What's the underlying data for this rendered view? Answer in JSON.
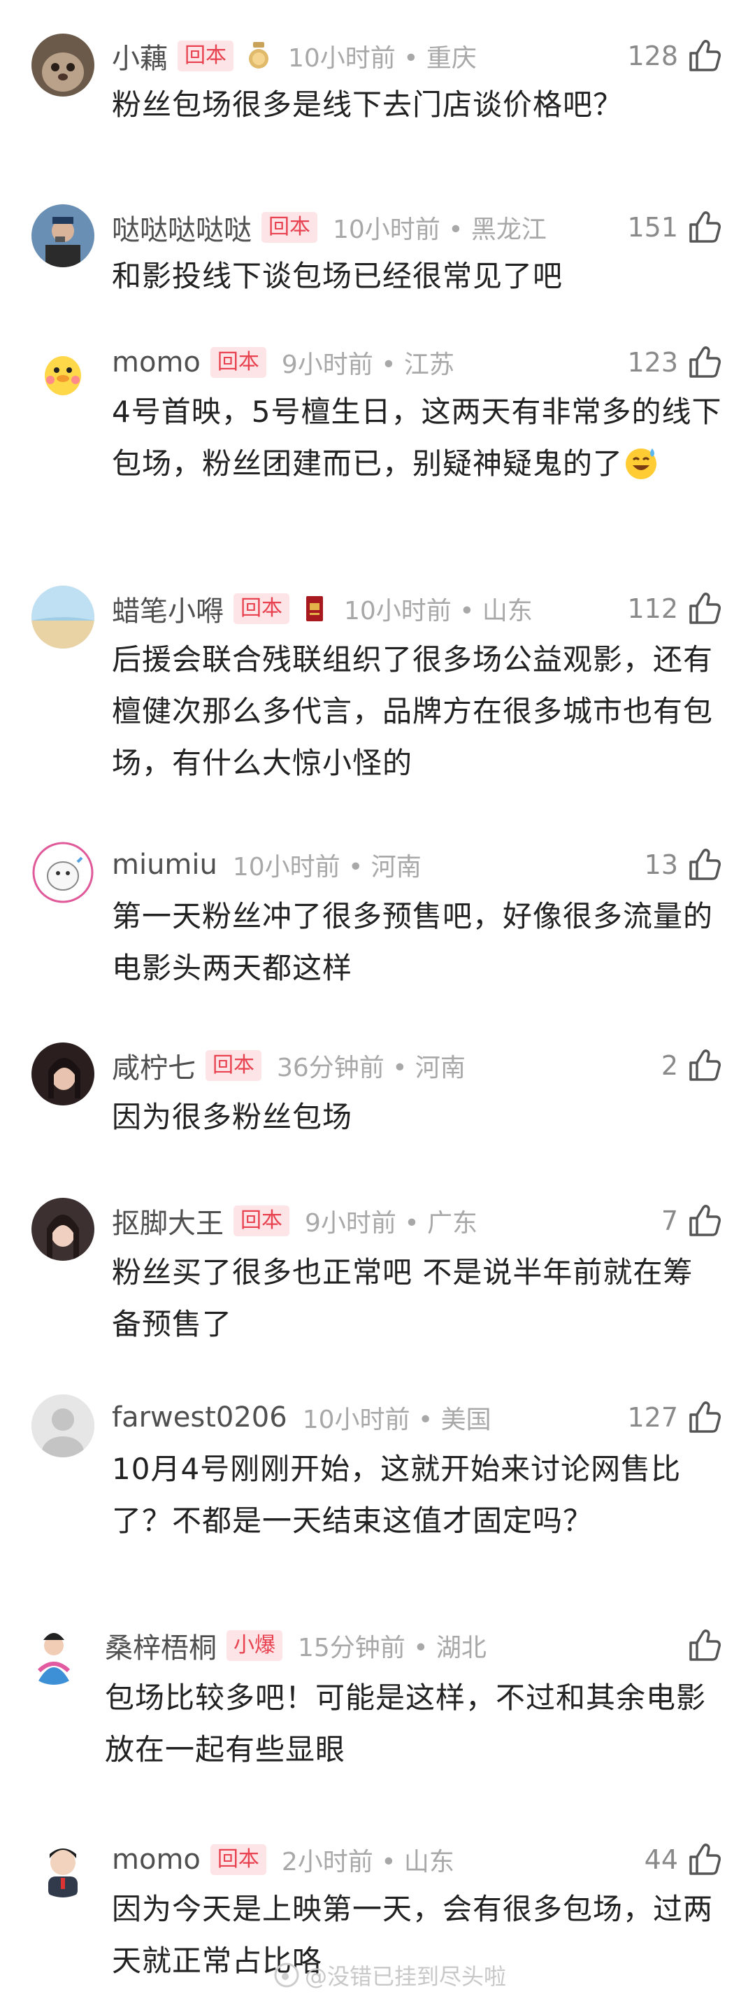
{
  "colors": {
    "badge_text": "#e8414f",
    "badge_bg": "#fde4e6",
    "meta": "#a8a8a8",
    "name": "#4f4f4f",
    "body": "#222222"
  },
  "comments": [
    {
      "name": "小藕",
      "badge": "回本",
      "meta": "10小时前 • 重庆",
      "likes": "128",
      "text": "粉丝包场很多是线下去门店谈价格吧？",
      "medal": "gold-medal-icon"
    },
    {
      "name": "哒哒哒哒哒",
      "badge": "回本",
      "meta": "10小时前 • 黑龙江",
      "likes": "151",
      "text": "和影投线下谈包场已经很常见了吧"
    },
    {
      "name": "momo",
      "badge": "回本",
      "meta": "9小时前 • 江苏",
      "likes": "123",
      "text": "4号首映，5号檀生日，这两天有非常多的线下包场，粉丝团建而已，别疑神疑鬼的了",
      "emoji": "sweat-smile-emoji"
    },
    {
      "name": "蜡笔小嘚",
      "badge": "回本",
      "meta": "10小时前 • 山东",
      "likes": "112",
      "text": "后援会联合残联组织了很多场公益观影，还有檀健次那么多代言，品牌方在很多城市也有包场，有什么大惊小怪的",
      "medal": "red-book-medal-icon"
    },
    {
      "name": "miumiu",
      "badge": "",
      "meta": "10小时前 • 河南",
      "likes": "13",
      "text": "第一天粉丝冲了很多预售吧，好像很多流量的电影头两天都这样"
    },
    {
      "name": "咸柠七",
      "badge": "回本",
      "meta": "36分钟前 • 河南",
      "likes": "2",
      "text": "因为很多粉丝包场"
    },
    {
      "name": "抠脚大王",
      "badge": "回本",
      "meta": "9小时前 • 广东",
      "likes": "7",
      "text": "粉丝买了很多也正常吧 不是说半年前就在筹备预售了"
    },
    {
      "name": "farwest0206",
      "badge": "",
      "meta": "10小时前 • 美国",
      "likes": "127",
      "text": "10月4号刚刚开始，这就开始来讨论网售比了？不都是一天结束这值才固定吗？"
    },
    {
      "name": "桑梓梧桐",
      "badge": "小爆",
      "meta": "15分钟前 • 湖北",
      "likes": "",
      "text": "包场比较多吧！可能是这样，不过和其余电影放在一起有些显眼"
    },
    {
      "name": "momo",
      "badge": "回本",
      "meta": "2小时前 • 山东",
      "likes": "44",
      "text": "因为今天是上映第一天，会有很多包场，过两天就正常占比咯"
    }
  ],
  "watermark": "@没错已挂到尽头啦"
}
